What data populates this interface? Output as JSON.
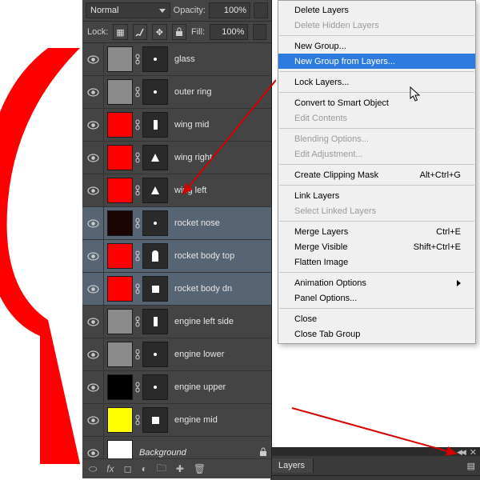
{
  "panel": {
    "blend_mode": "Normal",
    "opacity_label": "Opacity:",
    "opacity_value": "100%",
    "lock_label": "Lock:",
    "fill_label": "Fill:",
    "fill_value": "100%"
  },
  "layers": [
    {
      "name": "glass",
      "swatch": "#8a8a8a",
      "selected": false,
      "shape": "dot"
    },
    {
      "name": "outer ring",
      "swatch": "#8a8a8a",
      "selected": false,
      "shape": "dot"
    },
    {
      "name": "wing mid",
      "swatch": "#ff0000",
      "selected": false,
      "shape": "bar"
    },
    {
      "name": "wing right",
      "swatch": "#ff0000",
      "selected": false,
      "shape": "tri"
    },
    {
      "name": "wing left",
      "swatch": "#ff0000",
      "selected": false,
      "shape": "tri"
    },
    {
      "name": "rocket nose",
      "swatch": "#1a0404",
      "selected": true,
      "shape": "dot"
    },
    {
      "name": "rocket body top",
      "swatch": "#ff0000",
      "selected": true,
      "shape": "body"
    },
    {
      "name": "rocket body dn",
      "swatch": "#ff0000",
      "selected": true,
      "shape": "sq"
    },
    {
      "name": "engine left side",
      "swatch": "#8a8a8a",
      "selected": false,
      "shape": "bar"
    },
    {
      "name": "engine lower",
      "swatch": "#8a8a8a",
      "selected": false,
      "shape": "dot"
    },
    {
      "name": "engine upper",
      "swatch": "#000000",
      "selected": false,
      "shape": "dot"
    },
    {
      "name": "engine mid",
      "swatch": "#ffff00",
      "selected": false,
      "shape": "sq"
    }
  ],
  "background_layer": {
    "name": "Background"
  },
  "menu": [
    {
      "label": "Delete Layers",
      "disabled": false
    },
    {
      "label": "Delete Hidden Layers",
      "disabled": true
    },
    {
      "sep": true
    },
    {
      "label": "New Group..."
    },
    {
      "label": "New Group from Layers...",
      "highlight": true
    },
    {
      "sep": true
    },
    {
      "label": "Lock Layers..."
    },
    {
      "sep": true
    },
    {
      "label": "Convert to Smart Object"
    },
    {
      "label": "Edit Contents",
      "disabled": true
    },
    {
      "sep": true
    },
    {
      "label": "Blending Options...",
      "disabled": true
    },
    {
      "label": "Edit Adjustment...",
      "disabled": true
    },
    {
      "sep": true
    },
    {
      "label": "Create Clipping Mask",
      "shortcut": "Alt+Ctrl+G"
    },
    {
      "sep": true
    },
    {
      "label": "Link Layers"
    },
    {
      "label": "Select Linked Layers",
      "disabled": true
    },
    {
      "sep": true
    },
    {
      "label": "Merge Layers",
      "shortcut": "Ctrl+E"
    },
    {
      "label": "Merge Visible",
      "shortcut": "Shift+Ctrl+E"
    },
    {
      "label": "Flatten Image"
    },
    {
      "sep": true
    },
    {
      "label": "Animation Options",
      "submenu": true
    },
    {
      "label": "Panel Options..."
    },
    {
      "sep": true
    },
    {
      "label": "Close"
    },
    {
      "label": "Close Tab Group"
    }
  ],
  "layers_tab": {
    "label": "Layers"
  }
}
